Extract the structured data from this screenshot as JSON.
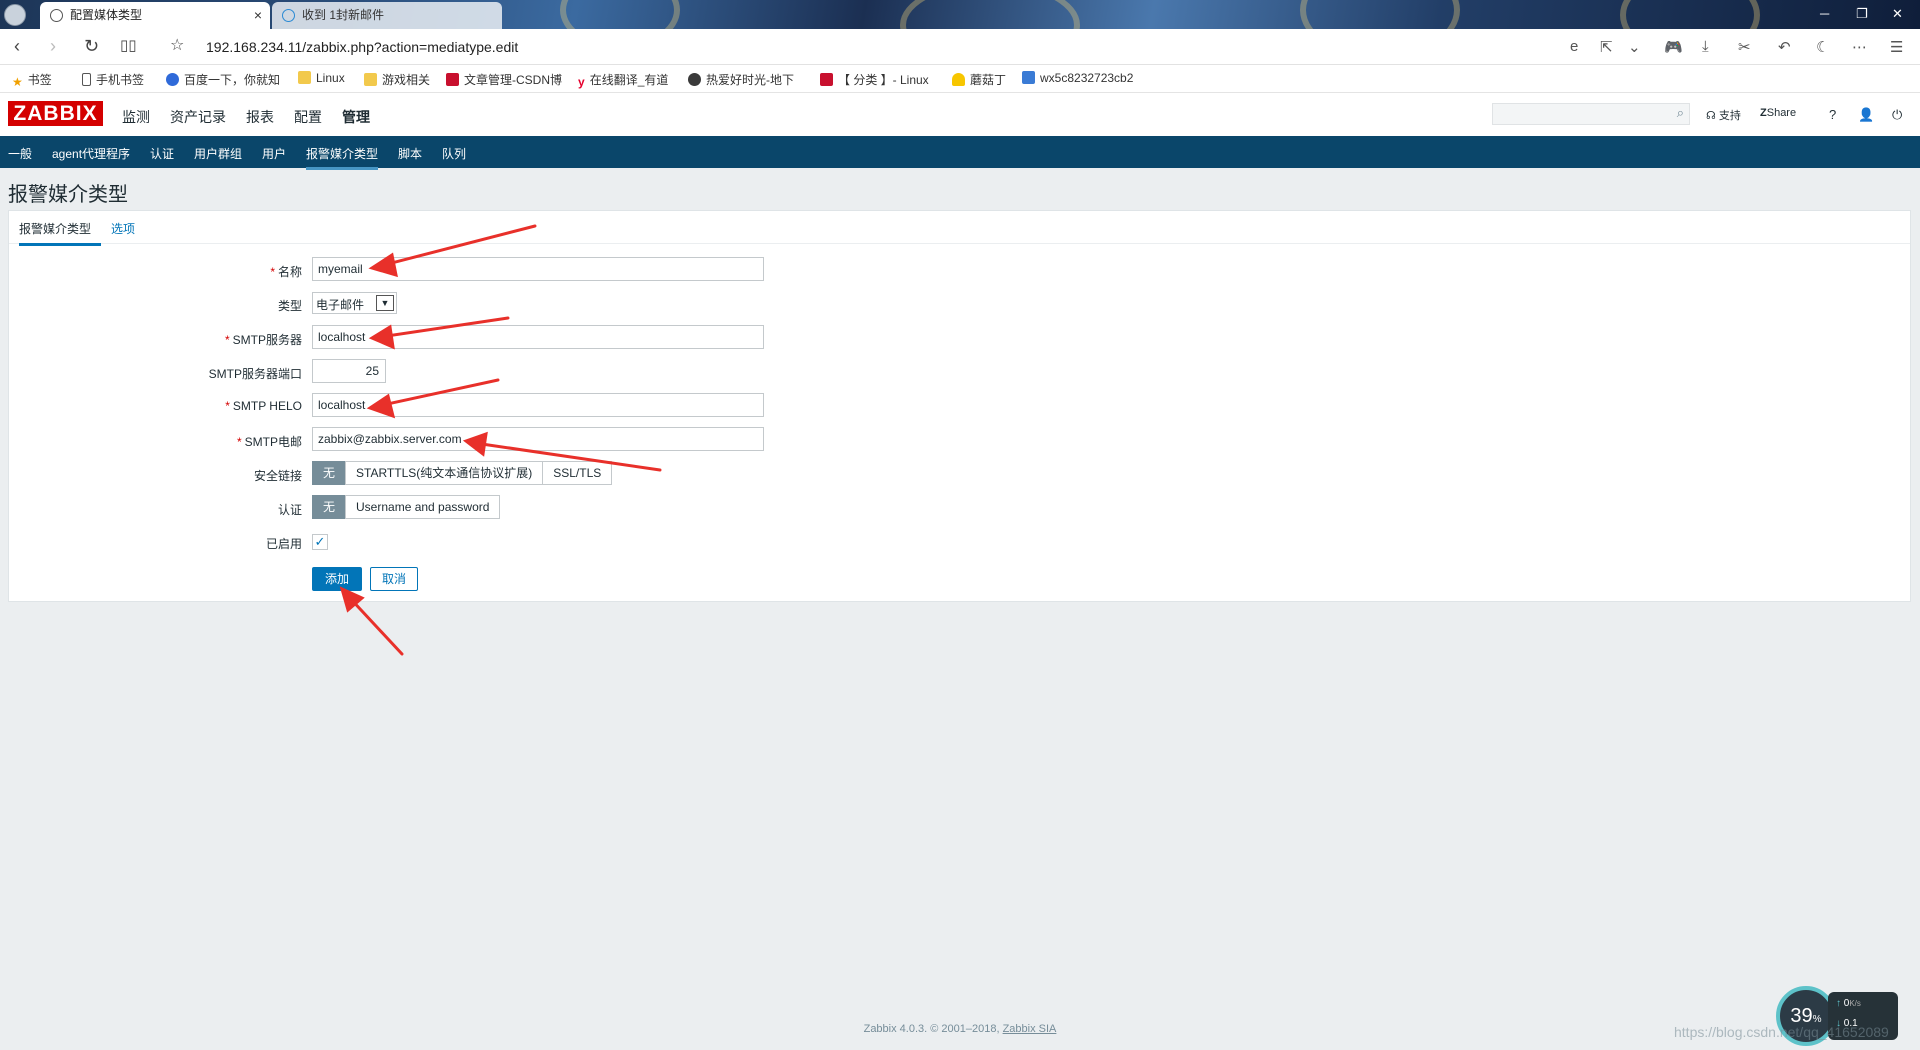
{
  "browser": {
    "tabs": [
      {
        "label": "配置媒体类型",
        "active": true
      },
      {
        "label": "收到 1封新邮件",
        "active": false
      }
    ],
    "url": "192.168.234.11/zabbix.php?action=mediatype.edit",
    "bookmarks": [
      {
        "label": "书签",
        "icon": "star-icon"
      },
      {
        "label": "手机书签",
        "icon": "phone-icon"
      },
      {
        "label": "百度一下，你就知",
        "icon": "baidu-icon"
      },
      {
        "label": "Linux",
        "icon": "folder-icon"
      },
      {
        "label": "游戏相关",
        "icon": "folder-icon"
      },
      {
        "label": "文章管理-CSDN博",
        "icon": "csdn-icon"
      },
      {
        "label": "在线翻译_有道",
        "icon": "youdao-icon"
      },
      {
        "label": "热爱好时光-地下",
        "icon": "site-icon"
      },
      {
        "label": "【 分类 】- Linux",
        "icon": "csdn-icon"
      },
      {
        "label": "蘑菇丁",
        "icon": "mushroom-icon"
      },
      {
        "label": "wx5c8232723cb2",
        "icon": "blog-icon"
      }
    ]
  },
  "zabbix": {
    "logo": "ZABBIX",
    "menu": [
      "监测",
      "资产记录",
      "报表",
      "配置",
      "管理"
    ],
    "active_menu": "管理",
    "header_links": {
      "support": "支持",
      "share": "Share",
      "help": "?"
    },
    "submenu": [
      "一般",
      "agent代理程序",
      "认证",
      "用户群组",
      "用户",
      "报警媒介类型",
      "脚本",
      "队列"
    ],
    "active_submenu": "报警媒介类型"
  },
  "page": {
    "title": "报警媒介类型",
    "tabs": {
      "media_type": "报警媒介类型",
      "options": "选项"
    },
    "form": {
      "name": {
        "label": "名称",
        "value": "myemail"
      },
      "type": {
        "label": "类型",
        "value": "电子邮件"
      },
      "smtp_server": {
        "label": "SMTP服务器",
        "value": "localhost"
      },
      "smtp_port": {
        "label": "SMTP服务器端口",
        "value": "25"
      },
      "smtp_helo": {
        "label": "SMTP HELO",
        "value": "localhost"
      },
      "smtp_email": {
        "label": "SMTP电邮",
        "value": "zabbix@zabbix.server.com"
      },
      "security": {
        "label": "安全链接",
        "options": [
          "无",
          "STARTTLS(纯文本通信协议扩展)",
          "SSL/TLS"
        ],
        "selected": "无"
      },
      "auth": {
        "label": "认证",
        "options": [
          "无",
          "Username and password"
        ],
        "selected": "无"
      },
      "enabled": {
        "label": "已启用",
        "checked": true
      },
      "add_button": "添加",
      "cancel_button": "取消"
    }
  },
  "footer": {
    "text": "Zabbix 4.0.3. © 2001–2018, ",
    "link": "Zabbix SIA"
  },
  "overlay": {
    "speed_percent": "39",
    "speed_unit": "%",
    "upload": "0",
    "upload_unit": "K/s",
    "download": "0.1",
    "watermark": "https://blog.csdn.net/qq_41652089"
  },
  "colors": {
    "zabbix_red": "#d40000",
    "subnav_blue": "#0a466a",
    "primary_blue": "#0275b8",
    "annotation_red": "#e8302a"
  }
}
